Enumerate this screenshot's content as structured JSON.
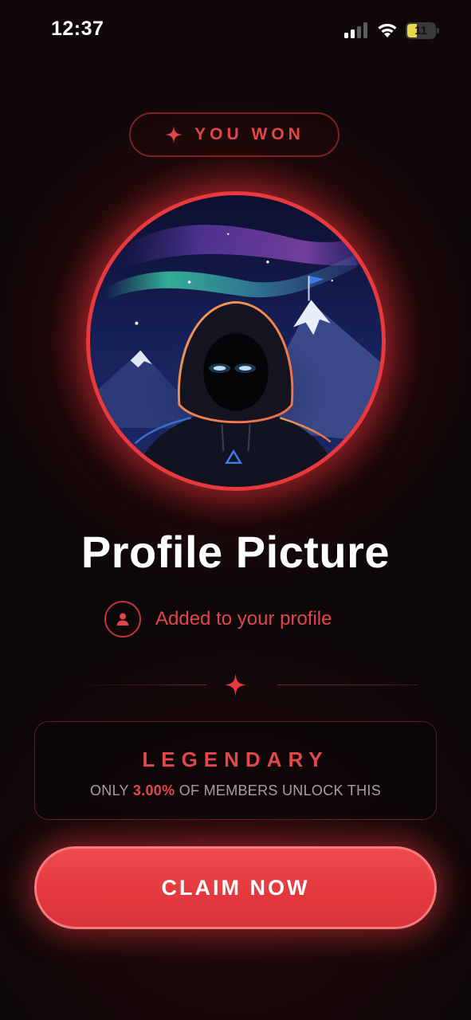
{
  "status_bar": {
    "time": "12:37",
    "battery": "11"
  },
  "badge": {
    "label": "YOU WON",
    "icon": "sparkle-icon"
  },
  "reward": {
    "title": "Profile Picture",
    "added_text": "Added to your profile",
    "added_icon": "user-icon"
  },
  "rarity": {
    "tier": "LEGENDARY",
    "prefix": "ONLY",
    "percent": "3.00%",
    "suffix": "OF MEMBERS UNLOCK THIS"
  },
  "cta": {
    "label": "CLAIM NOW"
  },
  "colors": {
    "accent": "#e8393e",
    "background": "#0b0709",
    "text": "#ffffff",
    "muted": "#a4a0a1"
  }
}
